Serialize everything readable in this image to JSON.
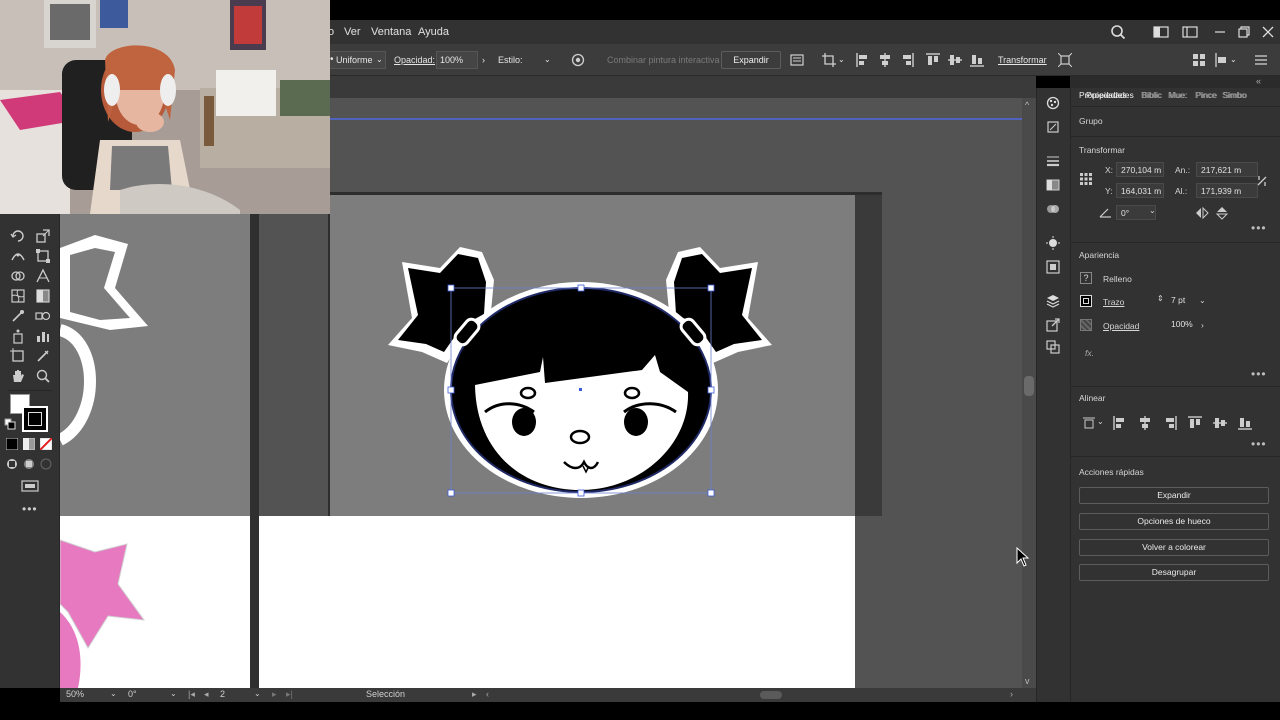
{
  "menu": {
    "items": [
      "Ver",
      "Ventana",
      "Ayuda"
    ],
    "partial": "o"
  },
  "control": {
    "stroke_profile": "Uniforme",
    "opacity_label": "Opacidad:",
    "opacity_value": "100%",
    "style_label": "Estilo:",
    "live_paint": "Combinar pintura interactiva",
    "expand_button": "Expandir",
    "transform_link": "Transformar"
  },
  "panel": {
    "tabs": [
      "Propiedades",
      "Biblic",
      "Mue:",
      "Pince",
      "Simbo"
    ],
    "group_label": "Grupo",
    "transform": {
      "title": "Transformar",
      "x_label": "X:",
      "x_value": "270,104 m",
      "y_label": "Y:",
      "y_value": "164,031 m",
      "w_label": "An.:",
      "w_value": "217,621 m",
      "h_label": "Al.:",
      "h_value": "171,939 m",
      "angle_value": "0°"
    },
    "appearance": {
      "title": "Apariencia",
      "fill_label": "Relleno",
      "stroke_label": "Trazo",
      "stroke_value": "7 pt",
      "opacity_label": "Opacidad",
      "opacity_value": "100%",
      "fx_label": "fx."
    },
    "align": {
      "title": "Alinear"
    },
    "quick_actions": {
      "title": "Acciones rápidas",
      "buttons": [
        "Expandir",
        "Opciones de hueco",
        "Volver a colorear",
        "Desagrupar"
      ]
    }
  },
  "status": {
    "zoom": "50%",
    "rotation": "0°",
    "artboard": "2",
    "tool": "Selección"
  },
  "colors": {
    "accent_pink": "#e779c1",
    "selection_blue": "#3b5bd6"
  }
}
